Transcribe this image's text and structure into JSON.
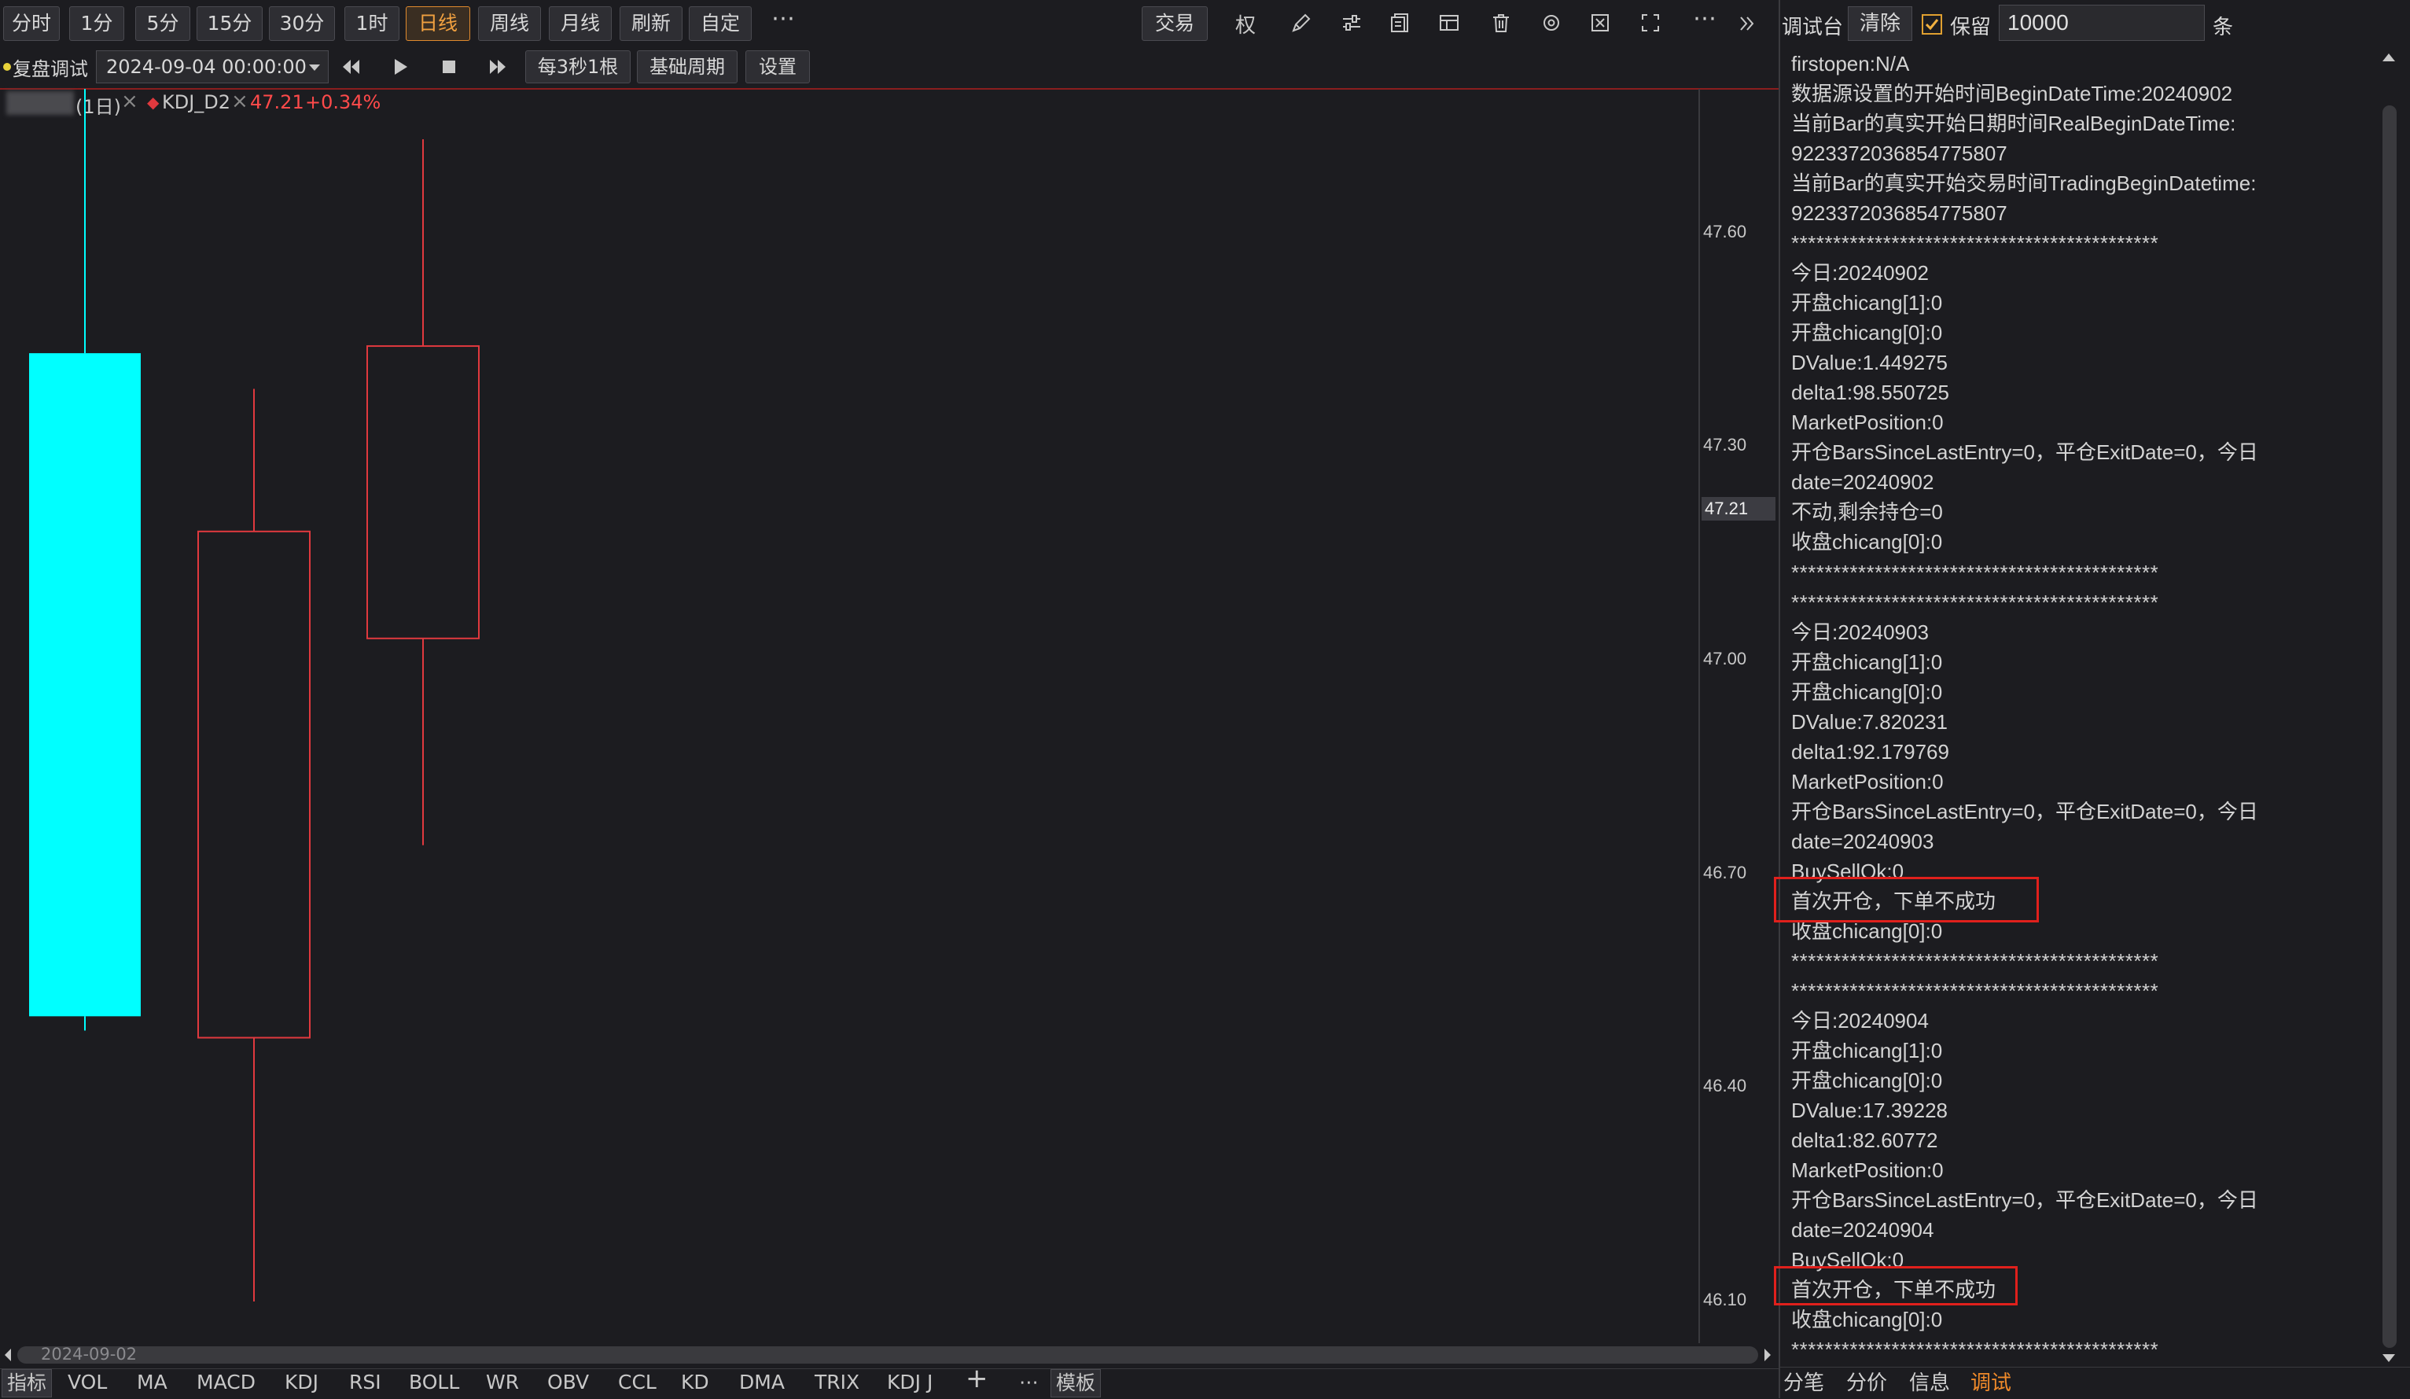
{
  "toolbar": {
    "periods": [
      "分时",
      "1分",
      "5分",
      "15分",
      "30分",
      "1时",
      "日线",
      "周线",
      "月线",
      "刷新",
      "自定"
    ],
    "active_period": "日线",
    "more": "⋯",
    "trade_button": "交易",
    "weight_button": "权"
  },
  "replay": {
    "label": "复盘调试",
    "datetime": "2024-09-04 00:00:00",
    "speed_button": "每3秒1根",
    "base_period_button": "基础周期",
    "settings_button": "设置"
  },
  "legend": {
    "period": "(1日)",
    "indicator": "KDJ_D2",
    "price": "47.21",
    "change": "+0.34%"
  },
  "price_axis": {
    "ticks": [
      "47.60",
      "47.30",
      "47.00",
      "46.70",
      "46.40",
      "46.10"
    ],
    "current": "47.21"
  },
  "time_axis": {
    "start_label": "2024-09-02"
  },
  "chart_data": {
    "type": "candlestick",
    "ylim": [
      46.07,
      47.8
    ],
    "candles": [
      {
        "open": 46.5,
        "close": 47.43,
        "high": 47.86,
        "low": 46.48,
        "color": "#00ffff"
      },
      {
        "open": 46.47,
        "close": 47.18,
        "high": 47.38,
        "low": 46.1,
        "color": "#e0393e"
      },
      {
        "open": 47.03,
        "close": 47.44,
        "high": 47.73,
        "low": 46.74,
        "color": "#e0393e"
      }
    ]
  },
  "indicator_bar": {
    "tabs": [
      "指标",
      "VOL",
      "MA",
      "MACD",
      "KDJ",
      "RSI",
      "BOLL",
      "WR",
      "OBV",
      "CCL",
      "KD",
      "DMA",
      "TRIX",
      "KDJ J"
    ],
    "add": "+",
    "more": "⋯",
    "template": "模板"
  },
  "debug": {
    "title": "调试台",
    "clear_button": "清除",
    "keep_label": "保留",
    "keep_count": "10000",
    "unit": "条",
    "log": [
      "firstopen:N/A",
      "数据源设置的开始时间BeginDateTime:20240902",
      "当前Bar的真实开始日期时间RealBeginDateTime:",
      "9223372036854775807",
      "当前Bar的真实开始交易时间TradingBeginDatetime:",
      "9223372036854775807",
      "********************************************",
      "今日:20240902",
      "开盘chicang[1]:0",
      "开盘chicang[0]:0",
      "DValue:1.449275",
      "delta1:98.550725",
      "MarketPosition:0",
      "开仓BarsSinceLastEntry=0，平仓ExitDate=0，今日",
      "date=20240902",
      "  不动,剩余持仓=0",
      "收盘chicang[0]:0",
      "********************************************",
      "********************************************",
      "今日:20240903",
      "开盘chicang[1]:0",
      "开盘chicang[0]:0",
      "DValue:7.820231",
      "delta1:92.179769",
      "MarketPosition:0",
      "开仓BarsSinceLastEntry=0，平仓ExitDate=0，今日",
      "date=20240903",
      "BuySellOk:0",
      "首次开仓，下单不成功",
      "收盘chicang[0]:0",
      "********************************************",
      "********************************************",
      "今日:20240904",
      "开盘chicang[1]:0",
      "开盘chicang[0]:0",
      "DValue:17.39228",
      "delta1:82.60772",
      "MarketPosition:0",
      "开仓BarsSinceLastEntry=0，平仓ExitDate=0，今日",
      "date=20240904",
      "BuySellOk:0",
      "首次开仓，下单不成功",
      "收盘chicang[0]:0",
      "********************************************"
    ],
    "tabs": [
      "分笔",
      "分价",
      "信息",
      "调试"
    ],
    "active_tab": "调试"
  }
}
